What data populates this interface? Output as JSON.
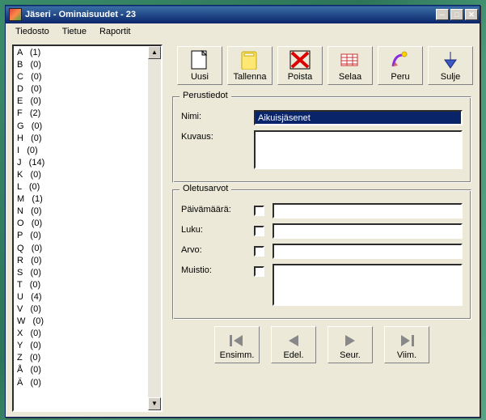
{
  "window": {
    "title": "Jäseri - Ominaisuudet - 23",
    "min": "_",
    "max": "□",
    "close": "×"
  },
  "menu": {
    "file": "Tiedosto",
    "tietue": "Tietue",
    "reports": "Raportit"
  },
  "list": {
    "items": [
      "A   (1)",
      "B   (0)",
      "C   (0)",
      "D   (0)",
      "E   (0)",
      "F   (2)",
      "G   (0)",
      "H   (0)",
      "I   (0)",
      "J   (14)",
      "K   (0)",
      "L   (0)",
      "M   (1)",
      "N   (0)",
      "O   (0)",
      "P   (0)",
      "Q   (0)",
      "R   (0)",
      "S   (0)",
      "T   (0)",
      "U   (4)",
      "V   (0)",
      "W   (0)",
      "X   (0)",
      "Y   (0)",
      "Z   (0)",
      "Å   (0)",
      "Ä   (0)"
    ]
  },
  "toolbar": {
    "new": "Uusi",
    "save": "Tallenna",
    "delete": "Poista",
    "browse": "Selaa",
    "undo": "Peru",
    "close": "Sulje"
  },
  "group1": {
    "legend": "Perustiedot",
    "name_label": "Nimi:",
    "name_value": "Aikuisjäsenet",
    "desc_label": "Kuvaus:",
    "desc_value": ""
  },
  "group2": {
    "legend": "Oletusarvot",
    "date_label": "Päivämäärä:",
    "num_label": "Luku:",
    "val_label": "Arvo:",
    "memo_label": "Muistio:",
    "date_value": "",
    "num_value": "",
    "val_value": "",
    "memo_value": ""
  },
  "nav": {
    "first": "Ensimm.",
    "prev": "Edel.",
    "next": "Seur.",
    "last": "Viim."
  }
}
